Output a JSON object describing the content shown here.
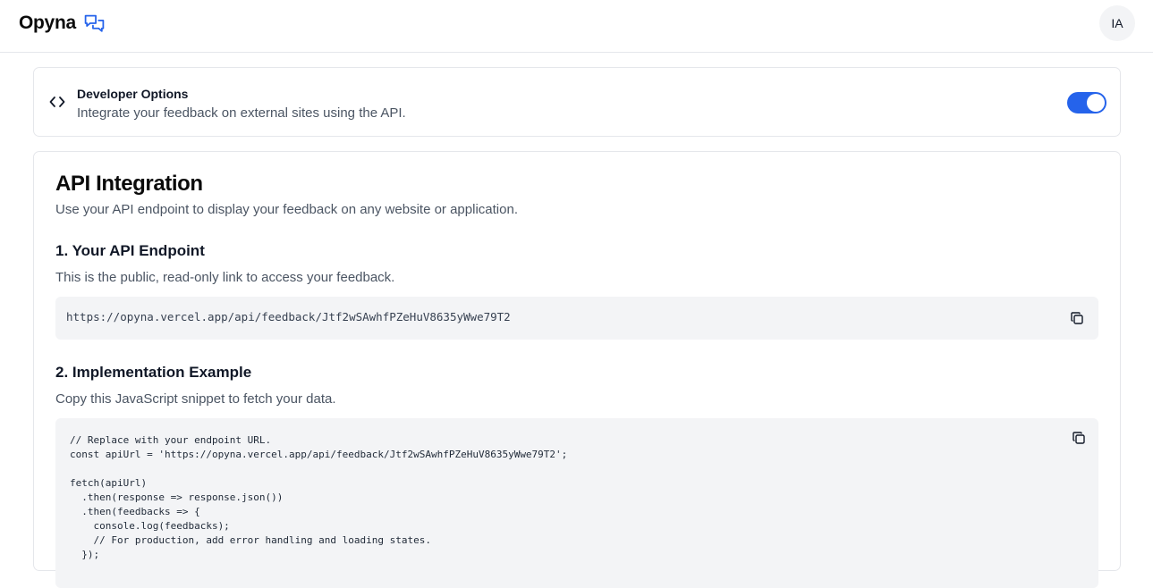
{
  "header": {
    "brand_name": "Opyna",
    "avatar_initials": "IA"
  },
  "developer_options": {
    "title": "Developer Options",
    "description": "Integrate your feedback on external sites using the API.",
    "toggle_enabled": true
  },
  "api_integration": {
    "title": "API Integration",
    "subtitle": "Use your API endpoint to display your feedback on any website or application.",
    "endpoint_section": {
      "title": "1. Your API Endpoint",
      "description": "This is the public, read-only link to access your feedback.",
      "url": "https://opyna.vercel.app/api/feedback/Jtf2wSAwhfPZeHuV8635yWwe79T2"
    },
    "implementation_section": {
      "title": "2. Implementation Example",
      "description": "Copy this JavaScript snippet to fetch your data.",
      "code": "// Replace with your endpoint URL.\nconst apiUrl = 'https://opyna.vercel.app/api/feedback/Jtf2wSAwhfPZeHuV8635yWwe79T2';\n\nfetch(apiUrl)\n  .then(response => response.json())\n  .then(feedbacks => {\n    console.log(feedbacks);\n    // For production, add error handling and loading states.\n  });"
    }
  },
  "colors": {
    "accent": "#2563eb",
    "code_background": "#f3f4f6",
    "border": "#e5e7eb"
  },
  "icons": {
    "brand": "chat-bubbles-icon",
    "developer": "code-brackets-icon",
    "copy": "copy-icon"
  }
}
